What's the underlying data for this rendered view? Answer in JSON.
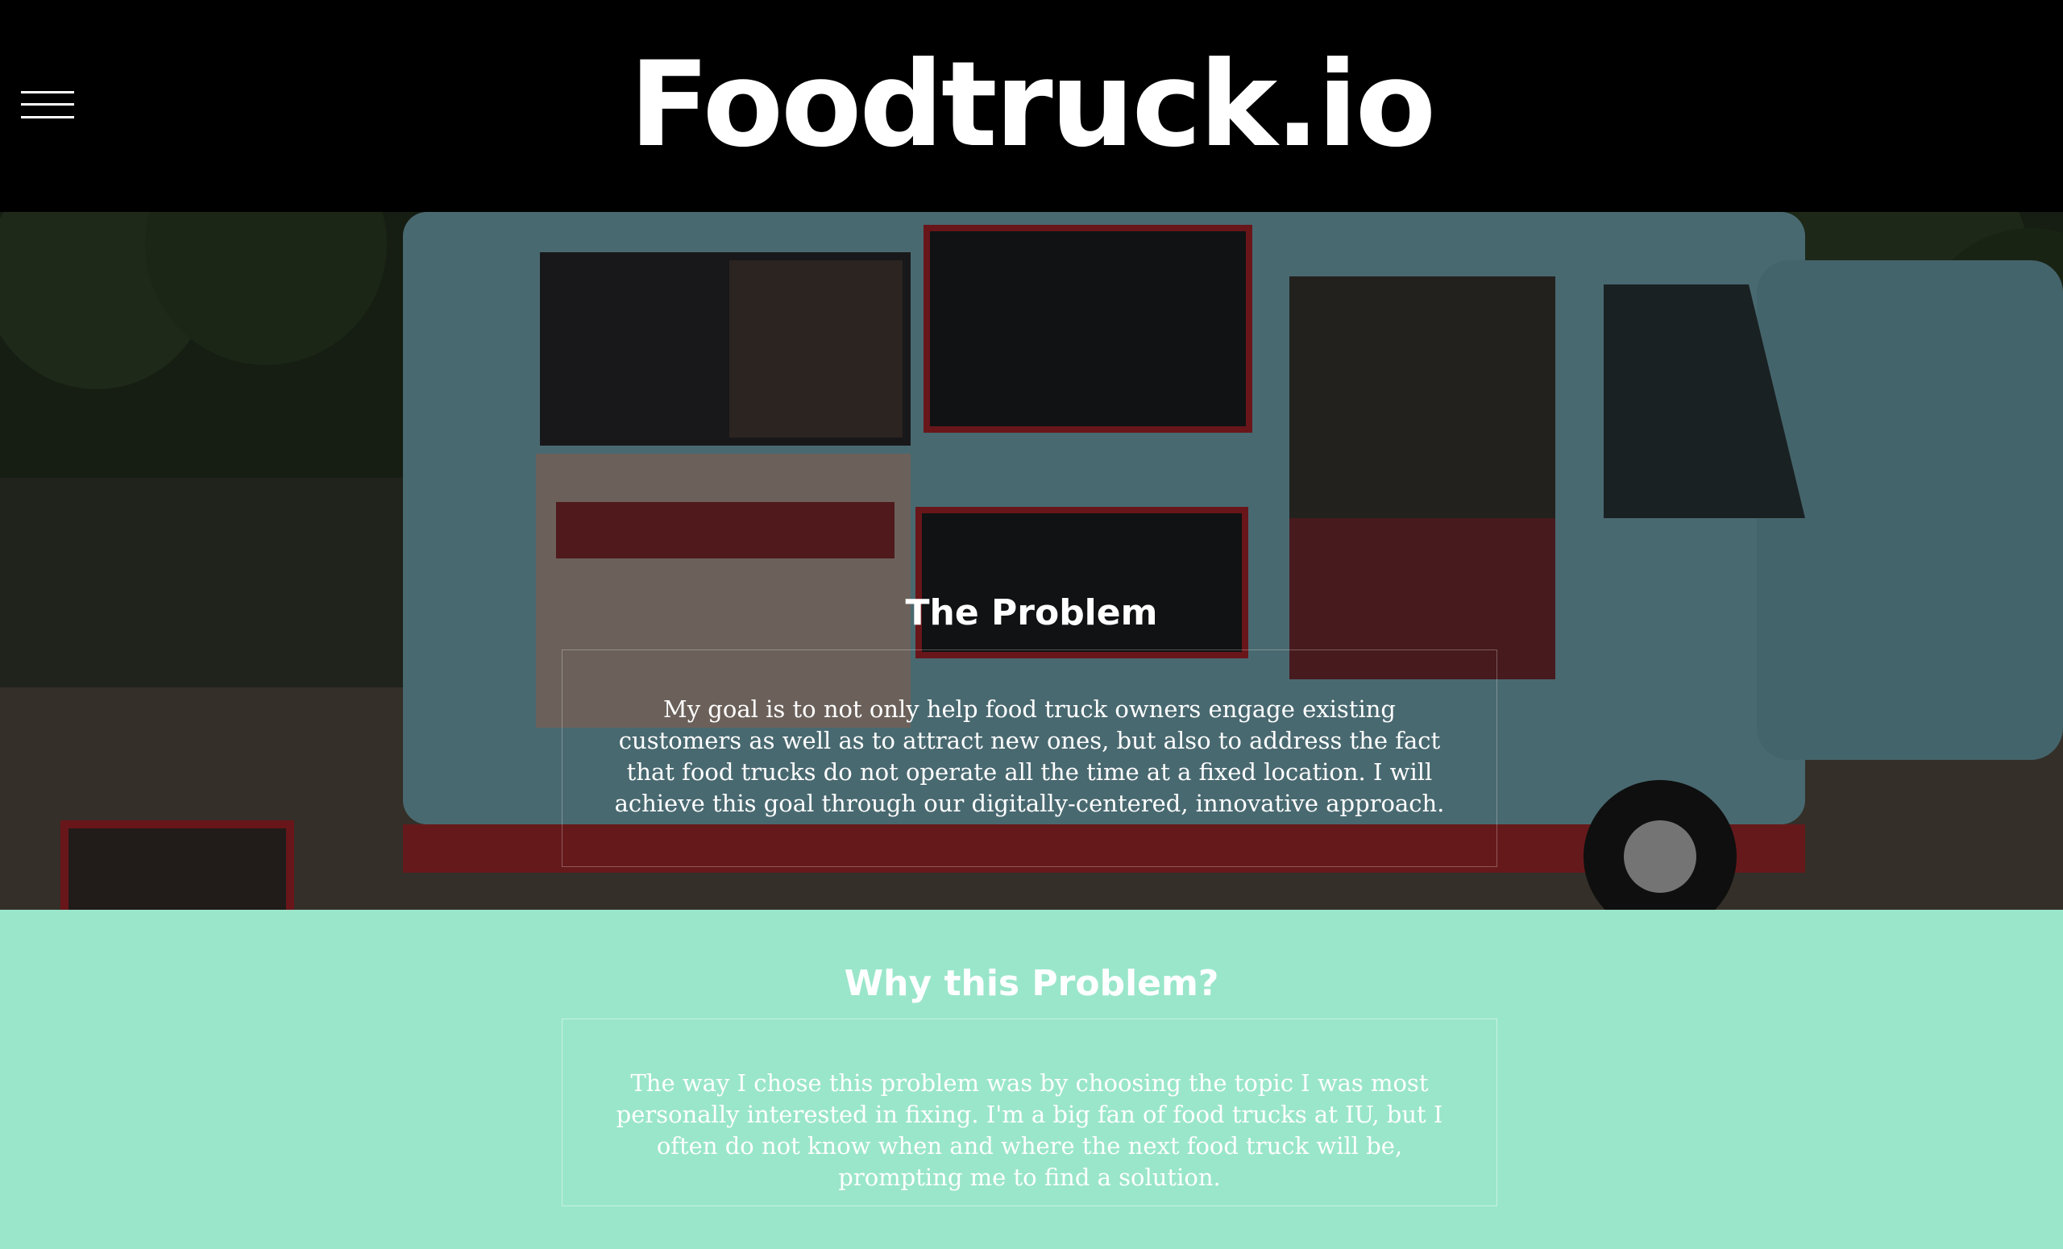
{
  "header": {
    "brand": "Foodtruck.io",
    "menu_icon": "hamburger-menu-icon"
  },
  "hero": {
    "title": "The Problem",
    "body": "My goal is to not only help food truck owners engage existing customers as well as to attract new ones, but also to address the fact that food trucks do not operate all the time at a fixed location. I will achieve this goal through our digitally-centered, innovative approach.",
    "background_image": "food-truck-photo"
  },
  "why": {
    "title": "Why this Problem?",
    "body": "The way I chose this problem was by choosing the topic I was most personally interested in fixing. I'm a big fan of food trucks at IU, but I often do not know when and where the next food truck will be, prompting me to find a solution."
  },
  "colors": {
    "header_bg": "#000000",
    "why_bg": "#9ae6cb",
    "text": "#ffffff"
  }
}
